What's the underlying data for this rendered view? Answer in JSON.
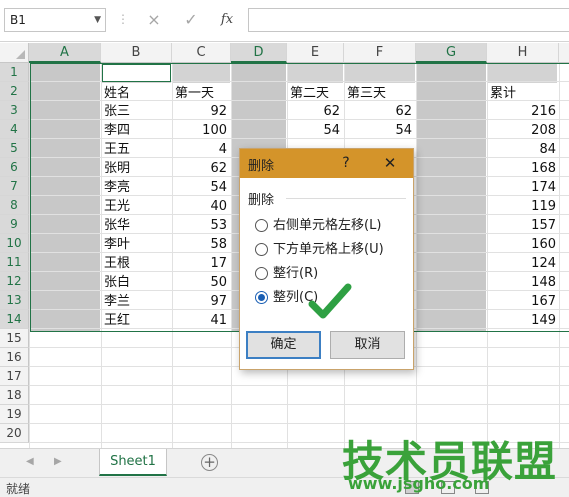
{
  "formula_bar": {
    "name_box": "B1",
    "cancel_icon": "×",
    "enter_icon": "✓",
    "fx_label": "fx",
    "formula_value": ""
  },
  "grid": {
    "columns": [
      "A",
      "B",
      "C",
      "D",
      "E",
      "F",
      "G",
      "H"
    ],
    "selected_columns": [
      "A",
      "D",
      "G"
    ],
    "rows": [
      "1",
      "2",
      "3",
      "4",
      "5",
      "6",
      "7",
      "8",
      "9",
      "10",
      "11",
      "12",
      "13",
      "14",
      "15",
      "16",
      "17",
      "18",
      "19",
      "20"
    ],
    "selected_rows": [
      "1",
      "2",
      "3",
      "4",
      "5",
      "6",
      "7",
      "8",
      "9",
      "10",
      "11",
      "12",
      "13",
      "14"
    ],
    "header_row": {
      "name": "姓名",
      "day1": "第一天",
      "day2": "第二天",
      "day3": "第三天",
      "total": "累计"
    },
    "records": [
      {
        "name": "张三",
        "day1": "92",
        "day2": "62",
        "day3": "62",
        "total": "216"
      },
      {
        "name": "李四",
        "day1": "100",
        "day2": "54",
        "day3": "54",
        "total": "208"
      },
      {
        "name": "王五",
        "day1": "4",
        "day2": "",
        "day3": "",
        "total": "84"
      },
      {
        "name": "张明",
        "day1": "62",
        "day2": "",
        "day3": "",
        "total": "168"
      },
      {
        "name": "李亮",
        "day1": "54",
        "day2": "",
        "day3": "",
        "total": "174"
      },
      {
        "name": "王光",
        "day1": "40",
        "day2": "",
        "day3": "",
        "total": "119"
      },
      {
        "name": "张华",
        "day1": "53",
        "day2": "",
        "day3": "",
        "total": "157"
      },
      {
        "name": "李叶",
        "day1": "58",
        "day2": "",
        "day3": "",
        "total": "160"
      },
      {
        "name": "王根",
        "day1": "17",
        "day2": "",
        "day3": "",
        "total": "124"
      },
      {
        "name": "张白",
        "day1": "50",
        "day2": "",
        "day3": "",
        "total": "148"
      },
      {
        "name": "李兰",
        "day1": "97",
        "day2": "",
        "day3": "",
        "total": "167"
      },
      {
        "name": "王红",
        "day1": "41",
        "day2": "",
        "day3": "",
        "total": "149"
      }
    ]
  },
  "dialog": {
    "title": "删除",
    "help": "?",
    "close": "✕",
    "group_label": "删除",
    "options": [
      {
        "label": "右侧单元格左移(L)",
        "selected": false
      },
      {
        "label": "下方单元格上移(U)",
        "selected": false
      },
      {
        "label": "整行(R)",
        "selected": false
      },
      {
        "label": "整列(C)",
        "selected": true
      }
    ],
    "ok_label": "确定",
    "cancel_label": "取消"
  },
  "tabs": {
    "sheet_name": "Sheet1",
    "add_icon": "+"
  },
  "status": {
    "text": "就绪"
  },
  "watermark": {
    "brand": "技术员联盟",
    "url": "www.jsgho.com"
  },
  "colors": {
    "accent": "#217346",
    "dialog_title": "#d4942a",
    "selection": "#c8c8c8",
    "check": "#2ea043",
    "watermark": "#3aa23a"
  }
}
